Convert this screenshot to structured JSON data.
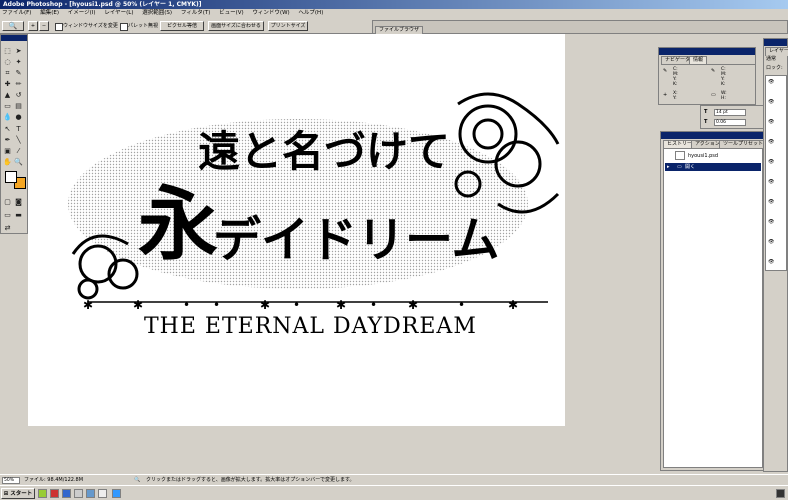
{
  "window": {
    "title": "Adobe Photoshop - [hyousi1.psd @ 50% (レイヤー 1, CMYK)]"
  },
  "menu": [
    "ファイル(F)",
    "編集(E)",
    "イメージ(I)",
    "レイヤー(L)",
    "選択範囲(S)",
    "フィルタ(T)",
    "ビュー(V)",
    "ウィンドウ(W)",
    "ヘルプ(H)"
  ],
  "options": {
    "resize_window_label": "ウィンドウサイズを変更",
    "ignore_palettes_label": "パレット無視",
    "actual_pixels": "ピクセル等倍",
    "fit_on_screen": "画面サイズに合わせる",
    "print_size": "プリントサイズ",
    "palette_well_tab": "ファイルブラウザ"
  },
  "artwork": {
    "title_top": "遠と名づけて",
    "title_bottom": "デイドリーム",
    "kanji": "永",
    "subtitle": "THE ETERNAL DAYDREAM"
  },
  "navigator_panel": {
    "tabs": [
      "ナビゲータ",
      "情報"
    ],
    "cmyk_labels": "C:\nM:\nY:\nK:",
    "xy_labels": "X:\nY:",
    "wh_labels": "W:\nH:"
  },
  "character_panel": {
    "size": "14 pt",
    "tracking": "0.06"
  },
  "history_panel": {
    "tabs": [
      "ヒストリー",
      "アクション",
      "ツールプリセット"
    ],
    "snapshot": "hyousi1.psd",
    "item": "開く"
  },
  "layers_panel": {
    "tab": "レイヤー",
    "mode": "通常",
    "lock_label": "ロック:"
  },
  "status": {
    "zoom": "50%",
    "file_info": "ファイル: 98.4M/122.8M",
    "hint": "クリックまたはドラッグすると、画像が拡大します。拡大率はオプションバーで変更します。"
  },
  "taskbar": {
    "start": "スタート"
  },
  "colors": {
    "foreground": "#ffffff",
    "background": "#f5a623",
    "titlebar": "#0a246a"
  }
}
